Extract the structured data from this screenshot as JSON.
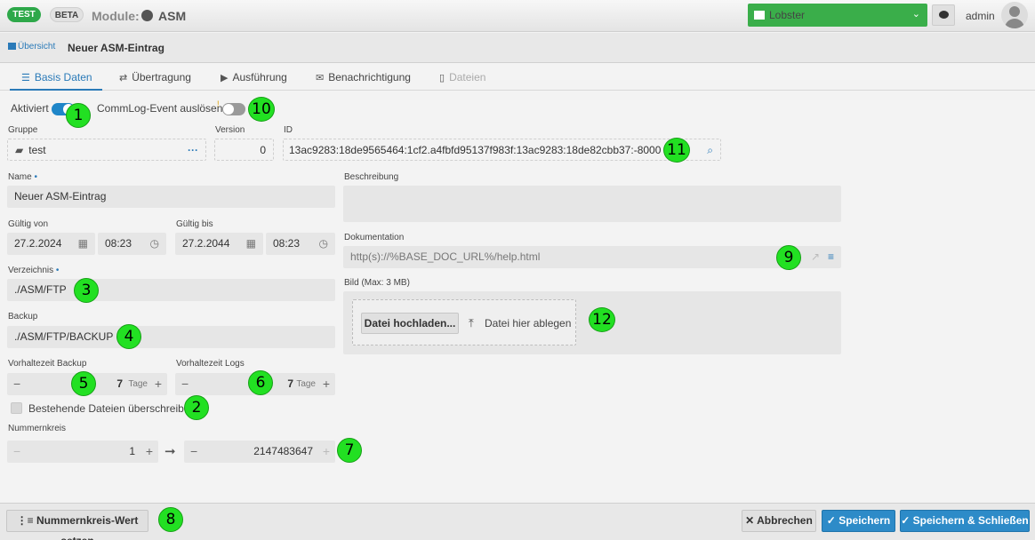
{
  "header": {
    "badge_test": "TEST",
    "badge_beta": "BETA",
    "module_label": "Module:",
    "module_name": "ASM",
    "tenant": "Lobster",
    "user": "admin"
  },
  "breadcrumb": {
    "overview": "Übersicht",
    "title": "Neuer ASM-Eintrag"
  },
  "tabs": [
    {
      "label": "Basis Daten",
      "icon": "list-icon",
      "state": "active"
    },
    {
      "label": "Übertragung",
      "icon": "transfer-icon",
      "state": "normal"
    },
    {
      "label": "Ausführung",
      "icon": "play-icon",
      "state": "normal"
    },
    {
      "label": "Benachrichtigung",
      "icon": "inbox-icon",
      "state": "normal"
    },
    {
      "label": "Dateien",
      "icon": "file-icon",
      "state": "disabled"
    }
  ],
  "form": {
    "active_label": "Aktiviert",
    "active_on": true,
    "commlog_label": "CommLog-Event auslösen",
    "commlog_on": false,
    "group_label": "Gruppe",
    "group_value": "test",
    "version_label": "Version",
    "version_value": "0",
    "id_label": "ID",
    "id_value": "13ac9283:18de9565464:1cf2.a4fbfd95137f983f:13ac9283:18de82cbb37:-8000",
    "name_label": "Name",
    "name_value": "Neuer ASM-Eintrag",
    "valid_from_label": "Gültig von",
    "valid_from_date": "27.2.2024",
    "valid_from_time": "08:23",
    "valid_to_label": "Gültig bis",
    "valid_to_date": "27.2.2044",
    "valid_to_time": "08:23",
    "directory_label": "Verzeichnis",
    "directory_value": "./ASM/FTP",
    "backup_label": "Backup",
    "backup_value": "./ASM/FTP/BACKUP",
    "retention_backup_label": "Vorhaltezeit Backup",
    "retention_backup_value": "7",
    "retention_logs_label": "Vorhaltezeit Logs",
    "retention_logs_value": "7",
    "unit_days": "Tage",
    "overwrite_label": "Bestehende Dateien überschreiben",
    "overwrite_checked": false,
    "numbercircle_label": "Nummernkreis",
    "numbercircle_from": "1",
    "numbercircle_to": "2147483647",
    "description_label": "Beschreibung",
    "description_value": "",
    "documentation_label": "Dokumentation",
    "documentation_value": "http(s)://%BASE_DOC_URL%/help.html",
    "image_label": "Bild (Max: 3 MB)",
    "upload_button": "Datei hochladen...",
    "drop_label": "Datei hier ablegen"
  },
  "markers": [
    "1",
    "2",
    "3",
    "4",
    "5",
    "6",
    "7",
    "8",
    "9",
    "10",
    "11",
    "12"
  ],
  "footer": {
    "set_number": "Nummernkreis-Wert setzen",
    "cancel": "Abbrechen",
    "save": "Speichern",
    "save_close": "Speichern & Schließen"
  },
  "colors": {
    "accent": "#2a7ab8",
    "primary_button": "#2d8bc8",
    "tenant": "#3aae4a",
    "badge_test": "#2ea84a",
    "marker": "#22e022"
  }
}
